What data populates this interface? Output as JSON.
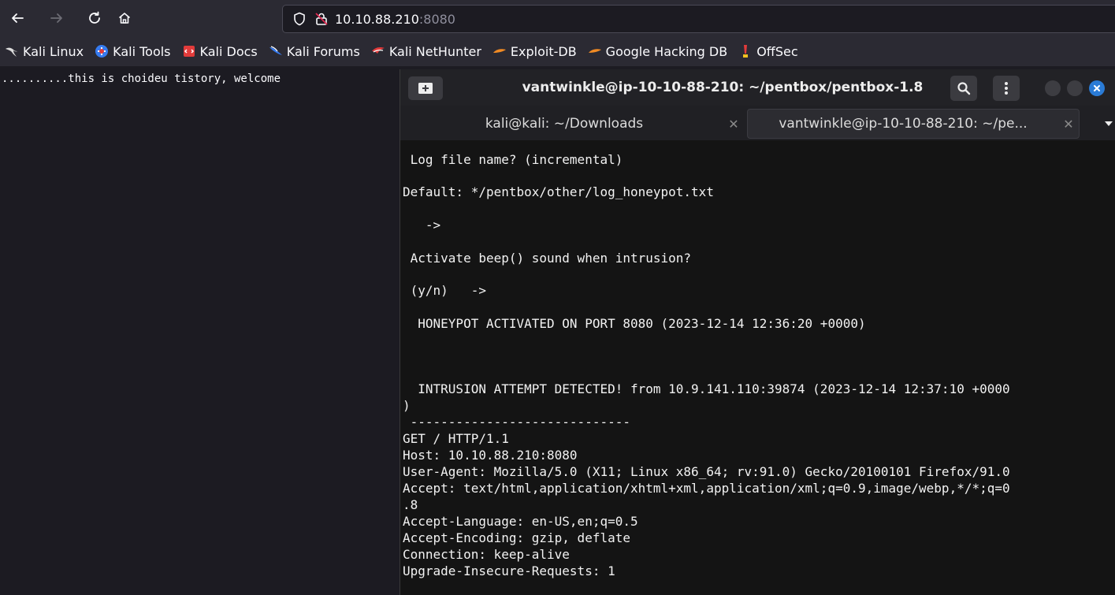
{
  "browser": {
    "url_host": "10.10.88.210",
    "url_port": ":8080",
    "bookmarks": [
      {
        "label": "Kali Linux",
        "icon": "kali-dragon-icon"
      },
      {
        "label": "Kali Tools",
        "icon": "kali-tools-icon"
      },
      {
        "label": "Kali Docs",
        "icon": "kali-docs-icon"
      },
      {
        "label": "Kali Forums",
        "icon": "kali-forums-icon"
      },
      {
        "label": "Kali NetHunter",
        "icon": "kali-nethunter-icon"
      },
      {
        "label": "Exploit-DB",
        "icon": "exploit-db-icon"
      },
      {
        "label": "Google Hacking DB",
        "icon": "ghdb-icon"
      },
      {
        "label": "OffSec",
        "icon": "offsec-icon"
      }
    ]
  },
  "page": {
    "text": "..........this is choideu tistory, welcome"
  },
  "terminal": {
    "title": "vantwinkle@ip-10-10-88-210: ~/pentbox/pentbox-1.8",
    "tabs": [
      {
        "label": "kali@kali: ~/Downloads",
        "active": false
      },
      {
        "label": "vantwinkle@ip-10-10-88-210: ~/pe...",
        "active": true
      }
    ],
    "lines": [
      " Log file name? (incremental)",
      "",
      "Default: */pentbox/other/log_honeypot.txt",
      "",
      "   ->",
      "",
      " Activate beep() sound when intrusion?",
      "",
      " (y/n)   ->",
      "",
      "  HONEYPOT ACTIVATED ON PORT 8080 (2023-12-14 12:36:20 +0000)",
      "",
      "",
      "",
      "  INTRUSION ATTEMPT DETECTED! from 10.9.141.110:39874 (2023-12-14 12:37:10 +0000",
      ")",
      " -----------------------------",
      "GET / HTTP/1.1",
      "Host: 10.10.88.210:8080",
      "User-Agent: Mozilla/5.0 (X11; Linux x86_64; rv:91.0) Gecko/20100101 Firefox/91.0",
      "Accept: text/html,application/xhtml+xml,application/xml;q=0.9,image/webp,*/*;q=0",
      ".8",
      "Accept-Language: en-US,en;q=0.5",
      "Accept-Encoding: gzip, deflate",
      "Connection: keep-alive",
      "Upgrade-Insecure-Requests: 1"
    ]
  }
}
